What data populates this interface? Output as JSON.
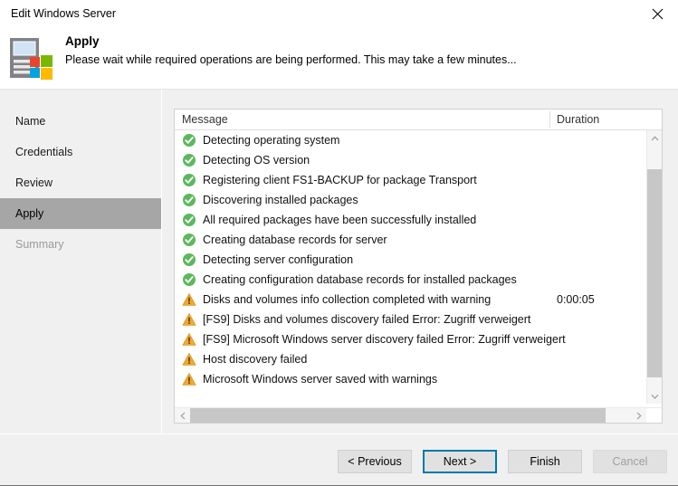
{
  "window": {
    "title": "Edit Windows Server",
    "close_label": "close-icon"
  },
  "header": {
    "title": "Apply",
    "subtitle": "Please wait while required operations are being performed. This may take a few minutes...",
    "icon": "windows-server-icon"
  },
  "sidebar": {
    "items": [
      {
        "label": "Name",
        "state": "normal"
      },
      {
        "label": "Credentials",
        "state": "normal"
      },
      {
        "label": "Review",
        "state": "normal"
      },
      {
        "label": "Apply",
        "state": "active"
      },
      {
        "label": "Summary",
        "state": "disabled"
      }
    ]
  },
  "list": {
    "columns": {
      "message": "Message",
      "duration": "Duration"
    },
    "rows": [
      {
        "status": "success",
        "message": "Detecting operating system",
        "duration": ""
      },
      {
        "status": "success",
        "message": "Detecting OS version",
        "duration": ""
      },
      {
        "status": "success",
        "message": "Registering client FS1-BACKUP for package Transport",
        "duration": ""
      },
      {
        "status": "success",
        "message": "Discovering installed packages",
        "duration": ""
      },
      {
        "status": "success",
        "message": "All required packages have been successfully installed",
        "duration": ""
      },
      {
        "status": "success",
        "message": "Creating database records for server",
        "duration": ""
      },
      {
        "status": "success",
        "message": "Detecting server configuration",
        "duration": ""
      },
      {
        "status": "success",
        "message": "Creating configuration database records for installed packages",
        "duration": ""
      },
      {
        "status": "warning",
        "message": "Disks and volumes info collection completed with warning",
        "duration": "0:00:05"
      },
      {
        "status": "warning",
        "message": "[FS9] Disks and volumes discovery failed Error: Zugriff verweigert",
        "duration": ""
      },
      {
        "status": "warning",
        "message": "[FS9] Microsoft Windows server discovery failed Error: Zugriff verweigert",
        "duration": ""
      },
      {
        "status": "warning",
        "message": "Host discovery failed",
        "duration": ""
      },
      {
        "status": "warning",
        "message": "Microsoft Windows server saved with warnings",
        "duration": ""
      }
    ]
  },
  "footer": {
    "previous": "< Previous",
    "next": "Next >",
    "finish": "Finish",
    "cancel": "Cancel"
  },
  "colors": {
    "success": "#5cb85c",
    "warning": "#f0a830",
    "focus_border": "#0078a8",
    "sidebar_active": "#a6a6a6",
    "panel_bg": "#f0f0f0"
  }
}
